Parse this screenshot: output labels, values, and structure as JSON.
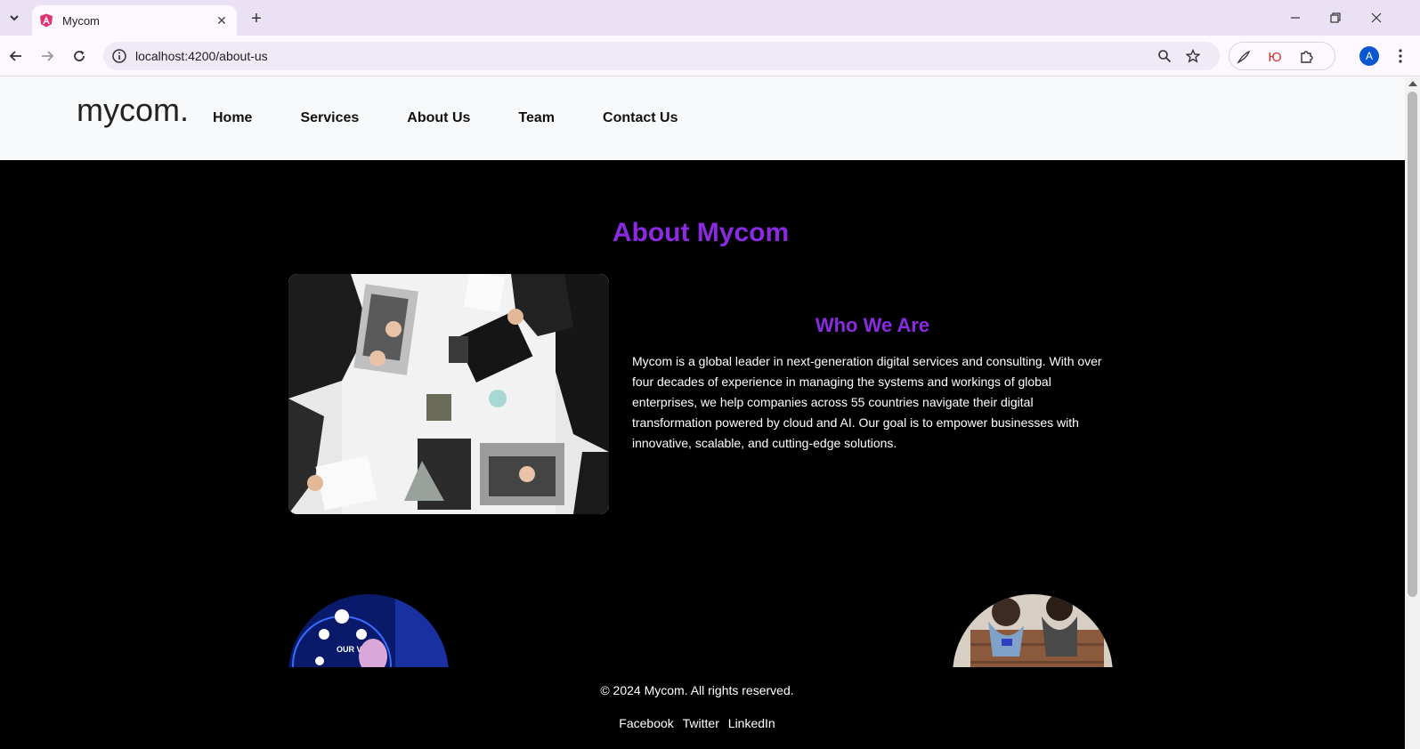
{
  "browser": {
    "tab_title": "Mycom",
    "url": "localhost:4200/about-us",
    "profile_initial": "A",
    "ext_label": "Ю"
  },
  "site": {
    "logo": "mycom.",
    "nav": [
      "Home",
      "Services",
      "About Us",
      "Team",
      "Contact Us"
    ],
    "page_title": "About Mycom",
    "who_title": "Who We Are",
    "who_text": "Mycom is a global leader in next-generation digital services and consulting. With over four decades of experience in managing the systems and workings of global enterprises, we help companies across 55 countries navigate their digital transformation powered by cloud and AI. Our goal is to empower businesses with innovative, scalable, and cutting-edge solutions.",
    "vision_text": "OUR VISION",
    "footer": {
      "copyright": "© 2024 Mycom. All rights reserved.",
      "links": [
        "Facebook",
        "Twitter",
        "LinkedIn"
      ]
    }
  },
  "colors": {
    "accent": "#8a2be2",
    "header_bg": "#f8f9fa",
    "page_bg": "#000000"
  }
}
